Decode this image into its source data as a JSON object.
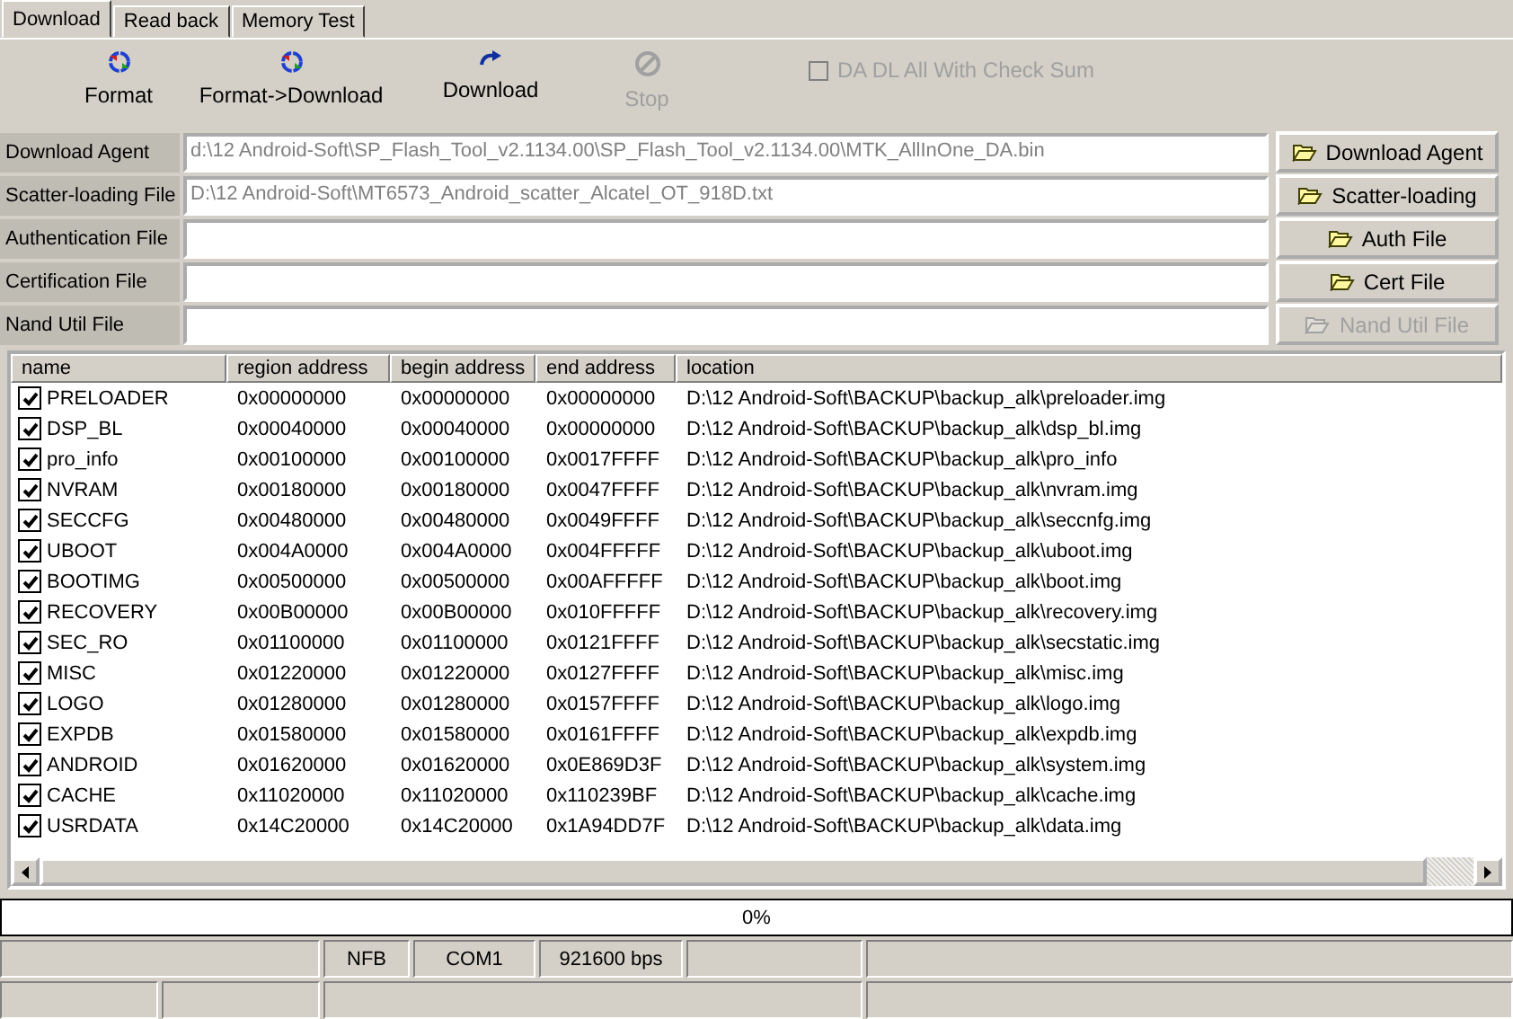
{
  "tabs": [
    {
      "label": "Download",
      "selected": true
    },
    {
      "label": "Read back",
      "selected": false
    },
    {
      "label": "Memory Test",
      "selected": false
    }
  ],
  "toolbar": [
    {
      "label": "Format",
      "kind": "format",
      "disabled": false
    },
    {
      "label": "Format->Download",
      "kind": "format",
      "disabled": false
    },
    {
      "label": "Download",
      "kind": "download",
      "disabled": false
    },
    {
      "label": "Stop",
      "kind": "stop",
      "disabled": true
    }
  ],
  "checksum": {
    "label": "DA DL All With Check Sum",
    "checked": false,
    "disabled": true
  },
  "files": [
    {
      "label": "Download Agent",
      "value": "d:\\12 Android-Soft\\SP_Flash_Tool_v2.1134.00\\SP_Flash_Tool_v2.1134.00\\MTK_AllInOne_DA.bin",
      "button": "Download Agent",
      "disabled": false
    },
    {
      "label": "Scatter-loading File",
      "value": "D:\\12 Android-Soft\\MT6573_Android_scatter_Alcatel_OT_918D.txt",
      "button": "Scatter-loading",
      "disabled": false
    },
    {
      "label": "Authentication File",
      "button": "Auth File",
      "disabled": false
    },
    {
      "label": "Certification File",
      "button": "Cert File",
      "disabled": false
    },
    {
      "label": "Nand Util File",
      "button": "Nand Util File",
      "disabled": true
    }
  ],
  "table": {
    "columns": [
      "name",
      "region address",
      "begin address",
      "end address",
      "location"
    ],
    "rows": [
      {
        "checked": true,
        "cells": [
          "PRELOADER",
          "0x00000000",
          "0x00000000",
          "0x00000000",
          "D:\\12 Android-Soft\\BACKUP\\backup_alk\\preloader.img"
        ]
      },
      {
        "checked": true,
        "cells": [
          "DSP_BL",
          "0x00040000",
          "0x00040000",
          "0x00000000",
          "D:\\12 Android-Soft\\BACKUP\\backup_alk\\dsp_bl.img"
        ]
      },
      {
        "checked": true,
        "cells": [
          "pro_info",
          "0x00100000",
          "0x00100000",
          "0x0017FFFF",
          "D:\\12 Android-Soft\\BACKUP\\backup_alk\\pro_info"
        ]
      },
      {
        "checked": true,
        "cells": [
          "NVRAM",
          "0x00180000",
          "0x00180000",
          "0x0047FFFF",
          "D:\\12 Android-Soft\\BACKUP\\backup_alk\\nvram.img"
        ]
      },
      {
        "checked": true,
        "cells": [
          "SECCFG",
          "0x00480000",
          "0x00480000",
          "0x0049FFFF",
          "D:\\12 Android-Soft\\BACKUP\\backup_alk\\seccnfg.img"
        ]
      },
      {
        "checked": true,
        "cells": [
          "UBOOT",
          "0x004A0000",
          "0x004A0000",
          "0x004FFFFF",
          "D:\\12 Android-Soft\\BACKUP\\backup_alk\\uboot.img"
        ]
      },
      {
        "checked": true,
        "cells": [
          "BOOTIMG",
          "0x00500000",
          "0x00500000",
          "0x00AFFFFF",
          "D:\\12 Android-Soft\\BACKUP\\backup_alk\\boot.img"
        ]
      },
      {
        "checked": true,
        "cells": [
          "RECOVERY",
          "0x00B00000",
          "0x00B00000",
          "0x010FFFFF",
          "D:\\12 Android-Soft\\BACKUP\\backup_alk\\recovery.img"
        ]
      },
      {
        "checked": true,
        "cells": [
          "SEC_RO",
          "0x01100000",
          "0x01100000",
          "0x0121FFFF",
          "D:\\12 Android-Soft\\BACKUP\\backup_alk\\secstatic.img"
        ]
      },
      {
        "checked": true,
        "cells": [
          "MISC",
          "0x01220000",
          "0x01220000",
          "0x0127FFFF",
          "D:\\12 Android-Soft\\BACKUP\\backup_alk\\misc.img"
        ]
      },
      {
        "checked": true,
        "cells": [
          "LOGO",
          "0x01280000",
          "0x01280000",
          "0x0157FFFF",
          "D:\\12 Android-Soft\\BACKUP\\backup_alk\\logo.img"
        ]
      },
      {
        "checked": true,
        "cells": [
          "EXPDB",
          "0x01580000",
          "0x01580000",
          "0x0161FFFF",
          "D:\\12 Android-Soft\\BACKUP\\backup_alk\\expdb.img"
        ]
      },
      {
        "checked": true,
        "cells": [
          "ANDROID",
          "0x01620000",
          "0x01620000",
          "0x0E869D3F",
          "D:\\12 Android-Soft\\BACKUP\\backup_alk\\system.img"
        ]
      },
      {
        "checked": true,
        "cells": [
          "CACHE",
          "0x11020000",
          "0x11020000",
          "0x110239BF",
          "D:\\12 Android-Soft\\BACKUP\\backup_alk\\cache.img"
        ]
      },
      {
        "checked": true,
        "cells": [
          "USRDATA",
          "0x14C20000",
          "0x14C20000",
          "0x1A94DD7F",
          "D:\\12 Android-Soft\\BACKUP\\backup_alk\\data.img"
        ]
      }
    ]
  },
  "progress": {
    "level": 0,
    "text": "0%"
  },
  "status_bar": [
    "NFB",
    "COM1",
    "921600 bps"
  ]
}
